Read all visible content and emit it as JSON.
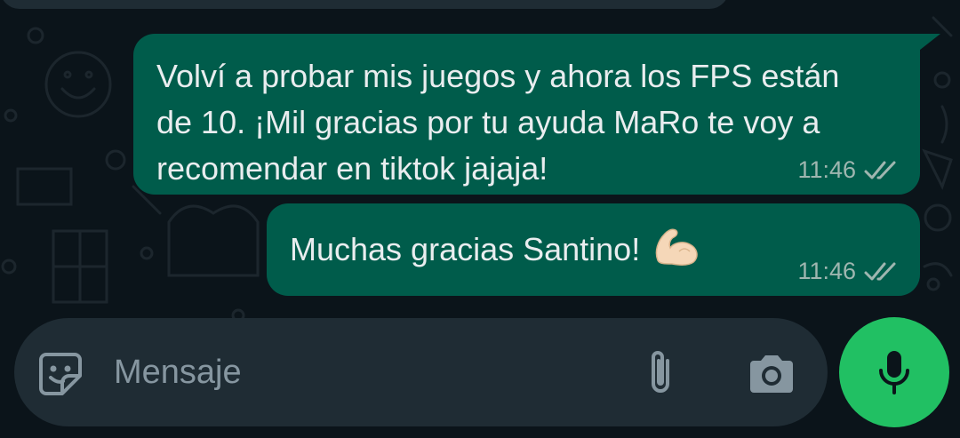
{
  "messages": [
    {
      "text": "Volví a probar mis juegos y ahora los FPS están de 10. ¡Mil gracias por tu ayuda MaRo te voy a recomendar en tiktok jajaja!",
      "time": "11:46",
      "status_icon": "double-check-icon"
    },
    {
      "text": "Muchas gracias Santino!",
      "emoji": "💪🏻",
      "time": "11:46",
      "status_icon": "double-check-icon"
    }
  ],
  "composer": {
    "placeholder": "Mensaje",
    "icons": [
      "sticker-emoji-icon",
      "paperclip-icon",
      "camera-icon",
      "microphone-icon"
    ]
  },
  "colors": {
    "background": "#0b141a",
    "outgoing_bubble": "#005c4b",
    "input_bar": "#1f2c34",
    "mic_button": "#21c063",
    "placeholder_text": "#8696a0"
  }
}
